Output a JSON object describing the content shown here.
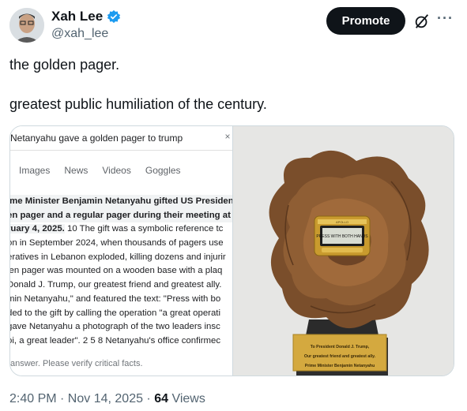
{
  "author": {
    "name": "Xah Lee",
    "handle": "@xah_lee",
    "verified_color": "#1d9bf0"
  },
  "actions": {
    "promote_label": "Promote",
    "grok_icon": "grok-icon",
    "more_label": "···"
  },
  "tweet": {
    "line1": "the golden pager.",
    "line2": "greatest public humiliation of the century."
  },
  "search_screenshot": {
    "query": "Netanyahu gave a golden pager to trump",
    "close": "×",
    "tabs": [
      "Images",
      "News",
      "Videos",
      "Goggles"
    ],
    "lines": [
      "ime Minister Benjamin Netanyahu gifted US President",
      "en pager and a regular pager during their meeting at t",
      "ruary 4, 2025.",
      "on in September 2024, when thousands of pagers use",
      "eratives in Lebanon exploded, killing dozens and injurir",
      "len pager was mounted on a wooden base with a plaq",
      "Donald J. Trump, our greatest friend and greatest ally.",
      "min Netanyahu,\" and featured the text: \"Press with bo",
      "ded to the gift by calling the operation \"a great operati",
      "gave Netanyahu a photograph of the two leaders insc",
      "oi, a great leader\".",
      "Netanyahu's office confirmec"
    ],
    "line3_rest": "The gift was a symbolic reference tc",
    "cite1": "10",
    "cites2": "2 5 8",
    "disclaimer": "answer. Please verify critical facts."
  },
  "photo": {
    "pager_screen": "PRESS WITH BOTH HANDS",
    "pager_brand": "APOLLO",
    "plaque_line1": "To President Donald J. Trump,",
    "plaque_line2": "Our greatest friend and greatest ally.",
    "plaque_line3": "Prime Minister Benjamin Netanyahu"
  },
  "meta": {
    "time": "2:40 PM · Nov 14, 2025 ·",
    "views_count": "64",
    "views_label": "Views"
  }
}
